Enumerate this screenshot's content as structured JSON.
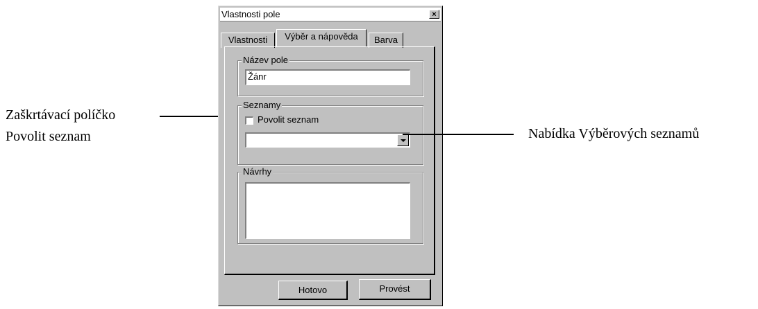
{
  "dialog": {
    "title": "Vlastnosti pole",
    "close_label": "×",
    "tabs": [
      {
        "label": "Vlastnosti",
        "active": false
      },
      {
        "label": "Výběr a nápověda",
        "active": true
      },
      {
        "label": "Barva",
        "active": false
      }
    ],
    "field_name_group": {
      "label": "Název pole",
      "value": "Žánr"
    },
    "lists_group": {
      "label": "Seznamy",
      "checkbox_label": "Povolit seznam",
      "checkbox_checked": false,
      "dropdown_value": ""
    },
    "suggestions_group": {
      "label": "Návrhy",
      "value": ""
    },
    "buttons": {
      "done": "Hotovo",
      "apply": "Provést"
    }
  },
  "callouts": {
    "checkbox_callout_line1": "Zaškrtávací políčko",
    "checkbox_callout_line2": "Povolit seznam",
    "dropdown_callout": "Nabídka Výběrových seznamů"
  }
}
